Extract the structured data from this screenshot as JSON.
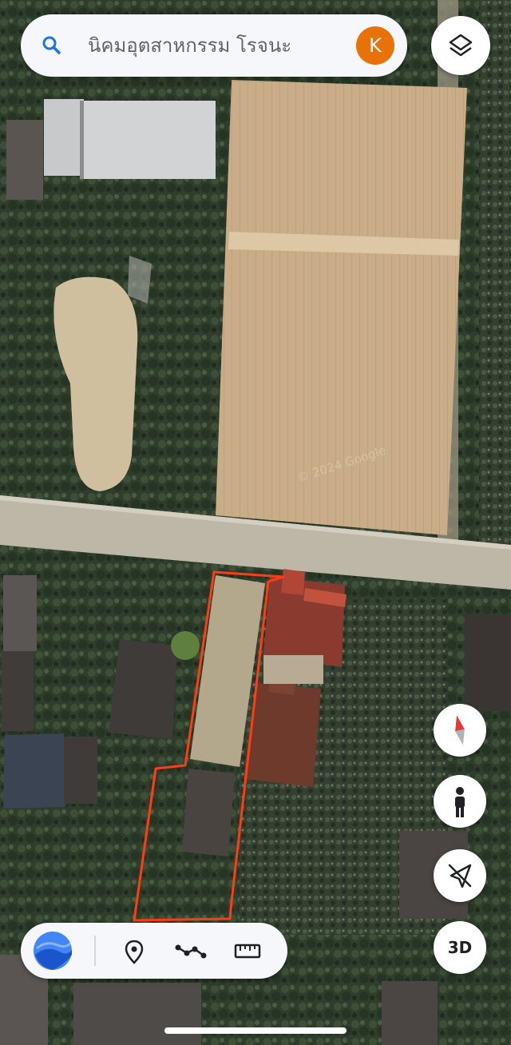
{
  "search": {
    "query": "นิคมอุตสาหกรรม โรจนะ",
    "avatar_initial": "K"
  },
  "watermark": "© 2024 Google",
  "controls": {
    "layers": "layers-icon",
    "compass": "compass-icon",
    "street_view": "pegman-icon",
    "location": "location-off-icon",
    "threed_label": "3D"
  },
  "toolbar": {
    "items": [
      "google-earth-icon",
      "pin-icon",
      "path-icon",
      "ruler-icon"
    ]
  },
  "colors": {
    "avatar_bg": "#e8710a",
    "search_icon": "#1a73e8",
    "boundary_line": "#ff3d14",
    "compass_red": "#e53935"
  }
}
